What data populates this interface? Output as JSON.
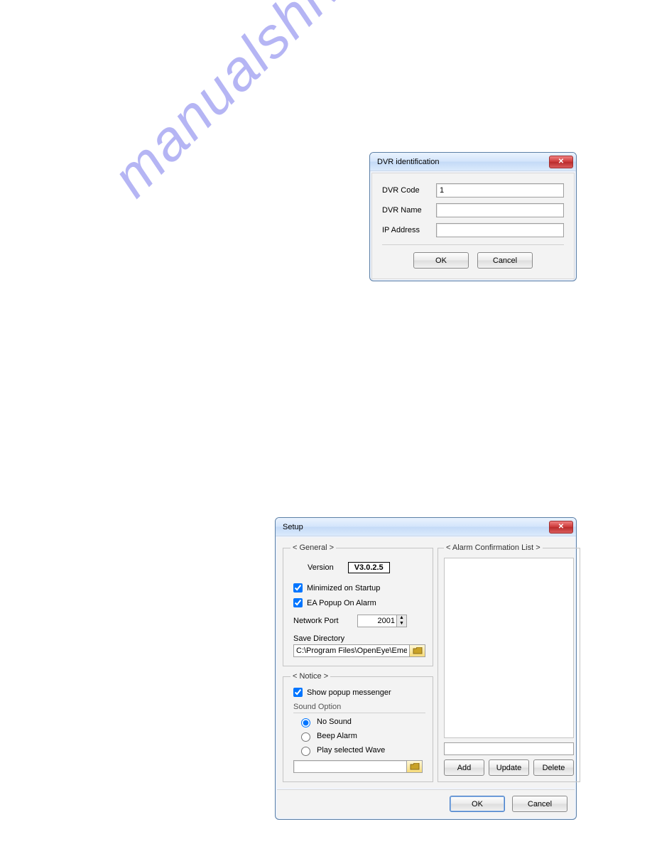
{
  "watermark": "manualshive.com",
  "dvr_dialog": {
    "title": "DVR identification",
    "labels": {
      "code": "DVR Code",
      "name": "DVR Name",
      "ip": "IP Address"
    },
    "values": {
      "code": "1",
      "name": "",
      "ip": ""
    },
    "buttons": {
      "ok": "OK",
      "cancel": "Cancel"
    }
  },
  "setup_dialog": {
    "title": "Setup",
    "general": {
      "legend": "< General >",
      "version_label": "Version",
      "version_value": "V3.0.2.5",
      "minimize_label": "Minimized on Startup",
      "minimize_checked": true,
      "ea_popup_label": "EA Popup On Alarm",
      "ea_popup_checked": true,
      "network_port_label": "Network Port",
      "network_port_value": "2001",
      "save_dir_label": "Save Directory",
      "save_dir_value": "C:\\Program Files\\OpenEye\\Emergency Agent\\E"
    },
    "notice": {
      "legend": "< Notice >",
      "show_popup_label": "Show popup messenger",
      "show_popup_checked": true,
      "sound_option_label": "Sound Option",
      "options": {
        "none": "No Sound",
        "beep": "Beep Alarm",
        "wave": "Play selected Wave"
      },
      "selected": "none",
      "wave_path": ""
    },
    "alarm": {
      "legend": "< Alarm Confirmation List >",
      "selected_text": "",
      "buttons": {
        "add": "Add",
        "update": "Update",
        "delete": "Delete"
      }
    },
    "footer": {
      "ok": "OK",
      "cancel": "Cancel"
    }
  }
}
